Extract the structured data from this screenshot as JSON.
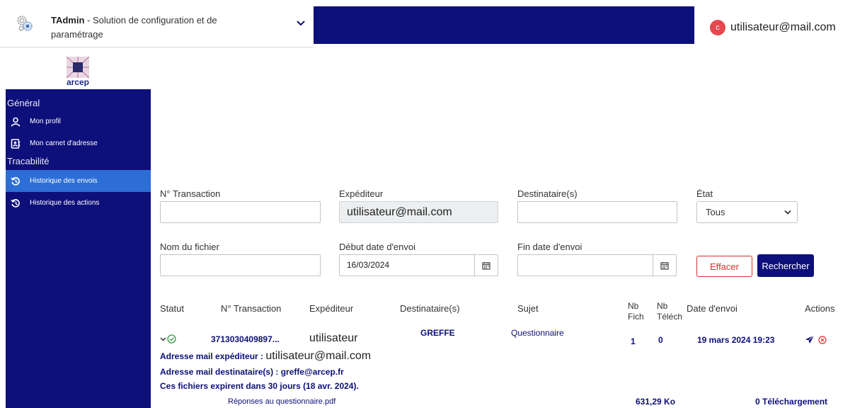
{
  "header": {
    "app_name": "TAdmin",
    "app_subtitle": " - Solution de configuration et de paramétrage",
    "user_initial": "c",
    "user_email": "utilisateur@mail.com"
  },
  "brand": {
    "logo_text": "arcep"
  },
  "sidebar": {
    "section_general": "Général",
    "items_general": [
      {
        "label": "Mon profil",
        "icon": "user-icon"
      },
      {
        "label": "Mon carnet d'adresse",
        "icon": "address-book-icon"
      }
    ],
    "section_tracabilite": "Tracabilité",
    "items_trace": [
      {
        "label": "Historique des envois",
        "icon": "history-icon",
        "active": true
      },
      {
        "label": "Historique des actions",
        "icon": "history-icon"
      }
    ]
  },
  "filters": {
    "transaction_label": "N° Transaction",
    "transaction_value": "",
    "sender_label": "Expéditeur",
    "sender_value": "utilisateur@mail.com",
    "recipients_label": "Destinataire(s)",
    "recipients_value": "",
    "state_label": "État",
    "state_value": "Tous",
    "filename_label": "Nom du fichier",
    "filename_value": "",
    "start_date_label": "Début date d'envoi",
    "start_date_value": "16/03/2024",
    "end_date_label": "Fin date d'envoi",
    "end_date_value": "",
    "clear_button": "Effacer",
    "search_button": "Rechercher"
  },
  "table": {
    "headers": {
      "status": "Statut",
      "transaction": "N° Transaction",
      "sender": "Expéditeur",
      "recipients": "Destinataire(s)",
      "subject": "Sujet",
      "nb_fich_1": "Nb",
      "nb_fich_2": "Fich",
      "nb_telech_1": "Nb",
      "nb_telech_2": "Téléch",
      "date": "Date d'envoi",
      "actions": "Actions"
    },
    "row": {
      "transaction": "3713030409897...",
      "sender": "utilisateur",
      "recipients": "GREFFE",
      "subject": "Questionnaire",
      "nb_fich": "1",
      "nb_telech": "0",
      "date": "19 mars 2024 19:23"
    },
    "details": {
      "sender_mail_label": "Adresse mail expéditeur : ",
      "sender_mail_value": "utilisateur@mail.com",
      "recipient_mail": "Adresse mail destinataire(s) : greffe@arcep.fr",
      "expiry": "Ces fichiers expirent dans 30 jours (18 avr. 2024).",
      "file_name": "Réponses au questionnaire.pdf",
      "file_size": "631,29 Ko",
      "downloads": "0 Téléchargement"
    }
  },
  "colors": {
    "primary": "#0d0f7a",
    "active": "#2c6dd6",
    "danger": "#d4302c"
  }
}
